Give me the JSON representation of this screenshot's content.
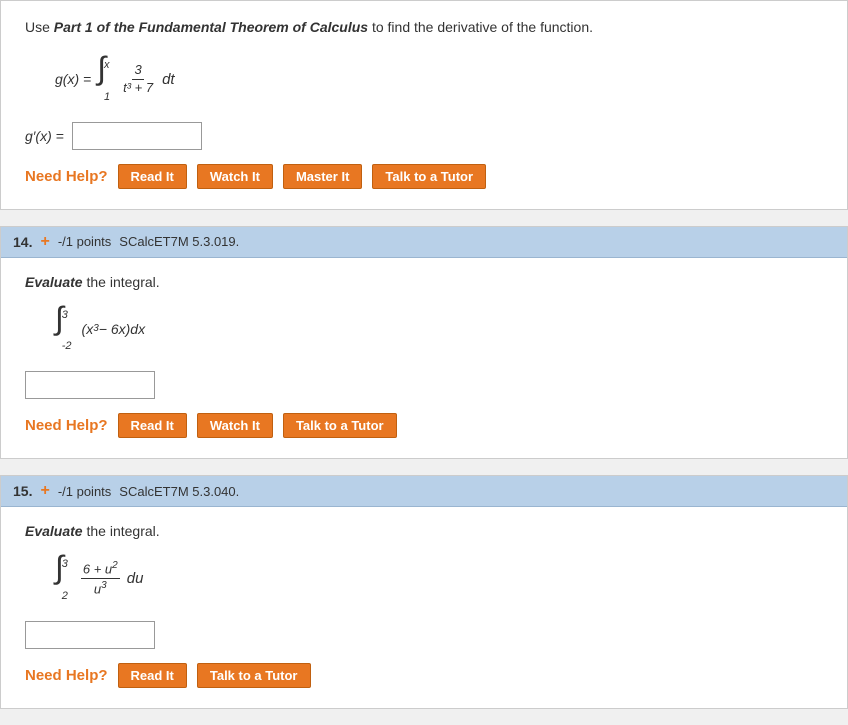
{
  "topProblem": {
    "instruction": "Use Part 1 of the Fundamental Theorem of Calculus to find the derivative of the function.",
    "functionLabel": "g(x) =",
    "integralLowerLimit": "1",
    "integralUpperLimit": "x",
    "integralNumerator": "3",
    "integralDenominator": "t³ + 7",
    "integralVar": "dt",
    "answerLabel": "g′(x) =",
    "needHelp": "Need Help?",
    "buttons": [
      "Read It",
      "Watch It",
      "Master It",
      "Talk to a Tutor"
    ]
  },
  "problem14": {
    "number": "14.",
    "plusSign": "+",
    "points": "-/1 points",
    "id": "SCalcET7M 5.3.019.",
    "instruction": "Evaluate the integral.",
    "integralLowerLimit": "-2",
    "integralUpperLimit": "3",
    "integralExpr": "(x³ − 6x)dx",
    "needHelp": "Need Help?",
    "buttons": [
      "Read It",
      "Watch It",
      "Talk to a Tutor"
    ]
  },
  "problem15": {
    "number": "15.",
    "plusSign": "+",
    "points": "-/1 points",
    "id": "SCalcET7M 5.3.040.",
    "instruction": "Evaluate the integral.",
    "integralLowerLimit": "2",
    "integralUpperLimit": "3",
    "integralNumerator": "6 + u²",
    "integralDenominator": "u³",
    "integralVar": "du",
    "needHelp": "Need Help?",
    "buttons": [
      "Read It",
      "Talk to a Tutor"
    ]
  }
}
